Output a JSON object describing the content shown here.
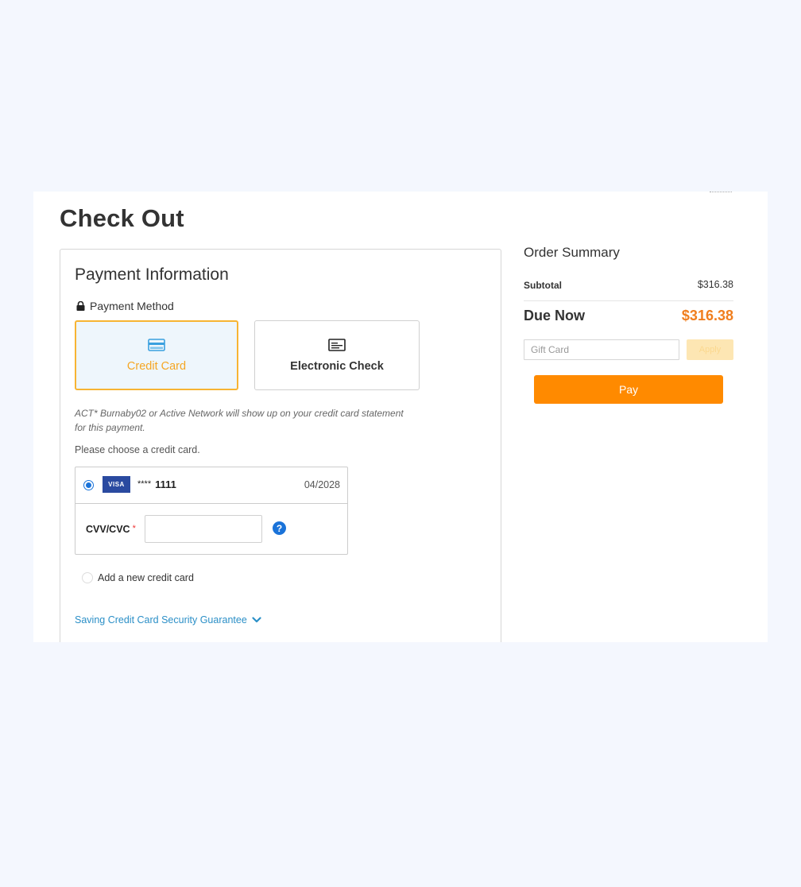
{
  "page": {
    "title": "Check Out"
  },
  "payment": {
    "title": "Payment Information",
    "method_label": "Payment Method",
    "methods": [
      {
        "label": "Credit Card",
        "icon": "credit-card-icon",
        "selected": true
      },
      {
        "label": "Electronic Check",
        "icon": "check-icon",
        "selected": false
      }
    ],
    "statement_note": "ACT* Burnaby02 or Active Network will show up on your credit card statement for this payment.",
    "choose_label": "Please choose a credit card.",
    "saved_card": {
      "brand": "VISA",
      "mask": "****",
      "last4": "1111",
      "expiry": "04/2028",
      "selected": true
    },
    "cvv": {
      "label": "CVV/CVC",
      "required_mark": "*",
      "value": "",
      "help": "?"
    },
    "add_card_label": "Add a new credit card",
    "guarantee_link": "Saving Credit Card Security Guarantee"
  },
  "summary": {
    "title": "Order Summary",
    "subtotal_label": "Subtotal",
    "subtotal_value": "$316.38",
    "due_label": "Due Now",
    "due_value": "$316.38",
    "gift_card_placeholder": "Gift Card",
    "apply_label": "Apply",
    "pay_label": "Pay"
  },
  "colors": {
    "accent_orange": "#ff8a00",
    "due_orange": "#f07e1e",
    "selected_border": "#f7b433",
    "link_blue": "#2b8fc7",
    "radio_blue": "#1a73d9",
    "visa_blue": "#2a4aa0",
    "background": "#f4f7fe"
  }
}
